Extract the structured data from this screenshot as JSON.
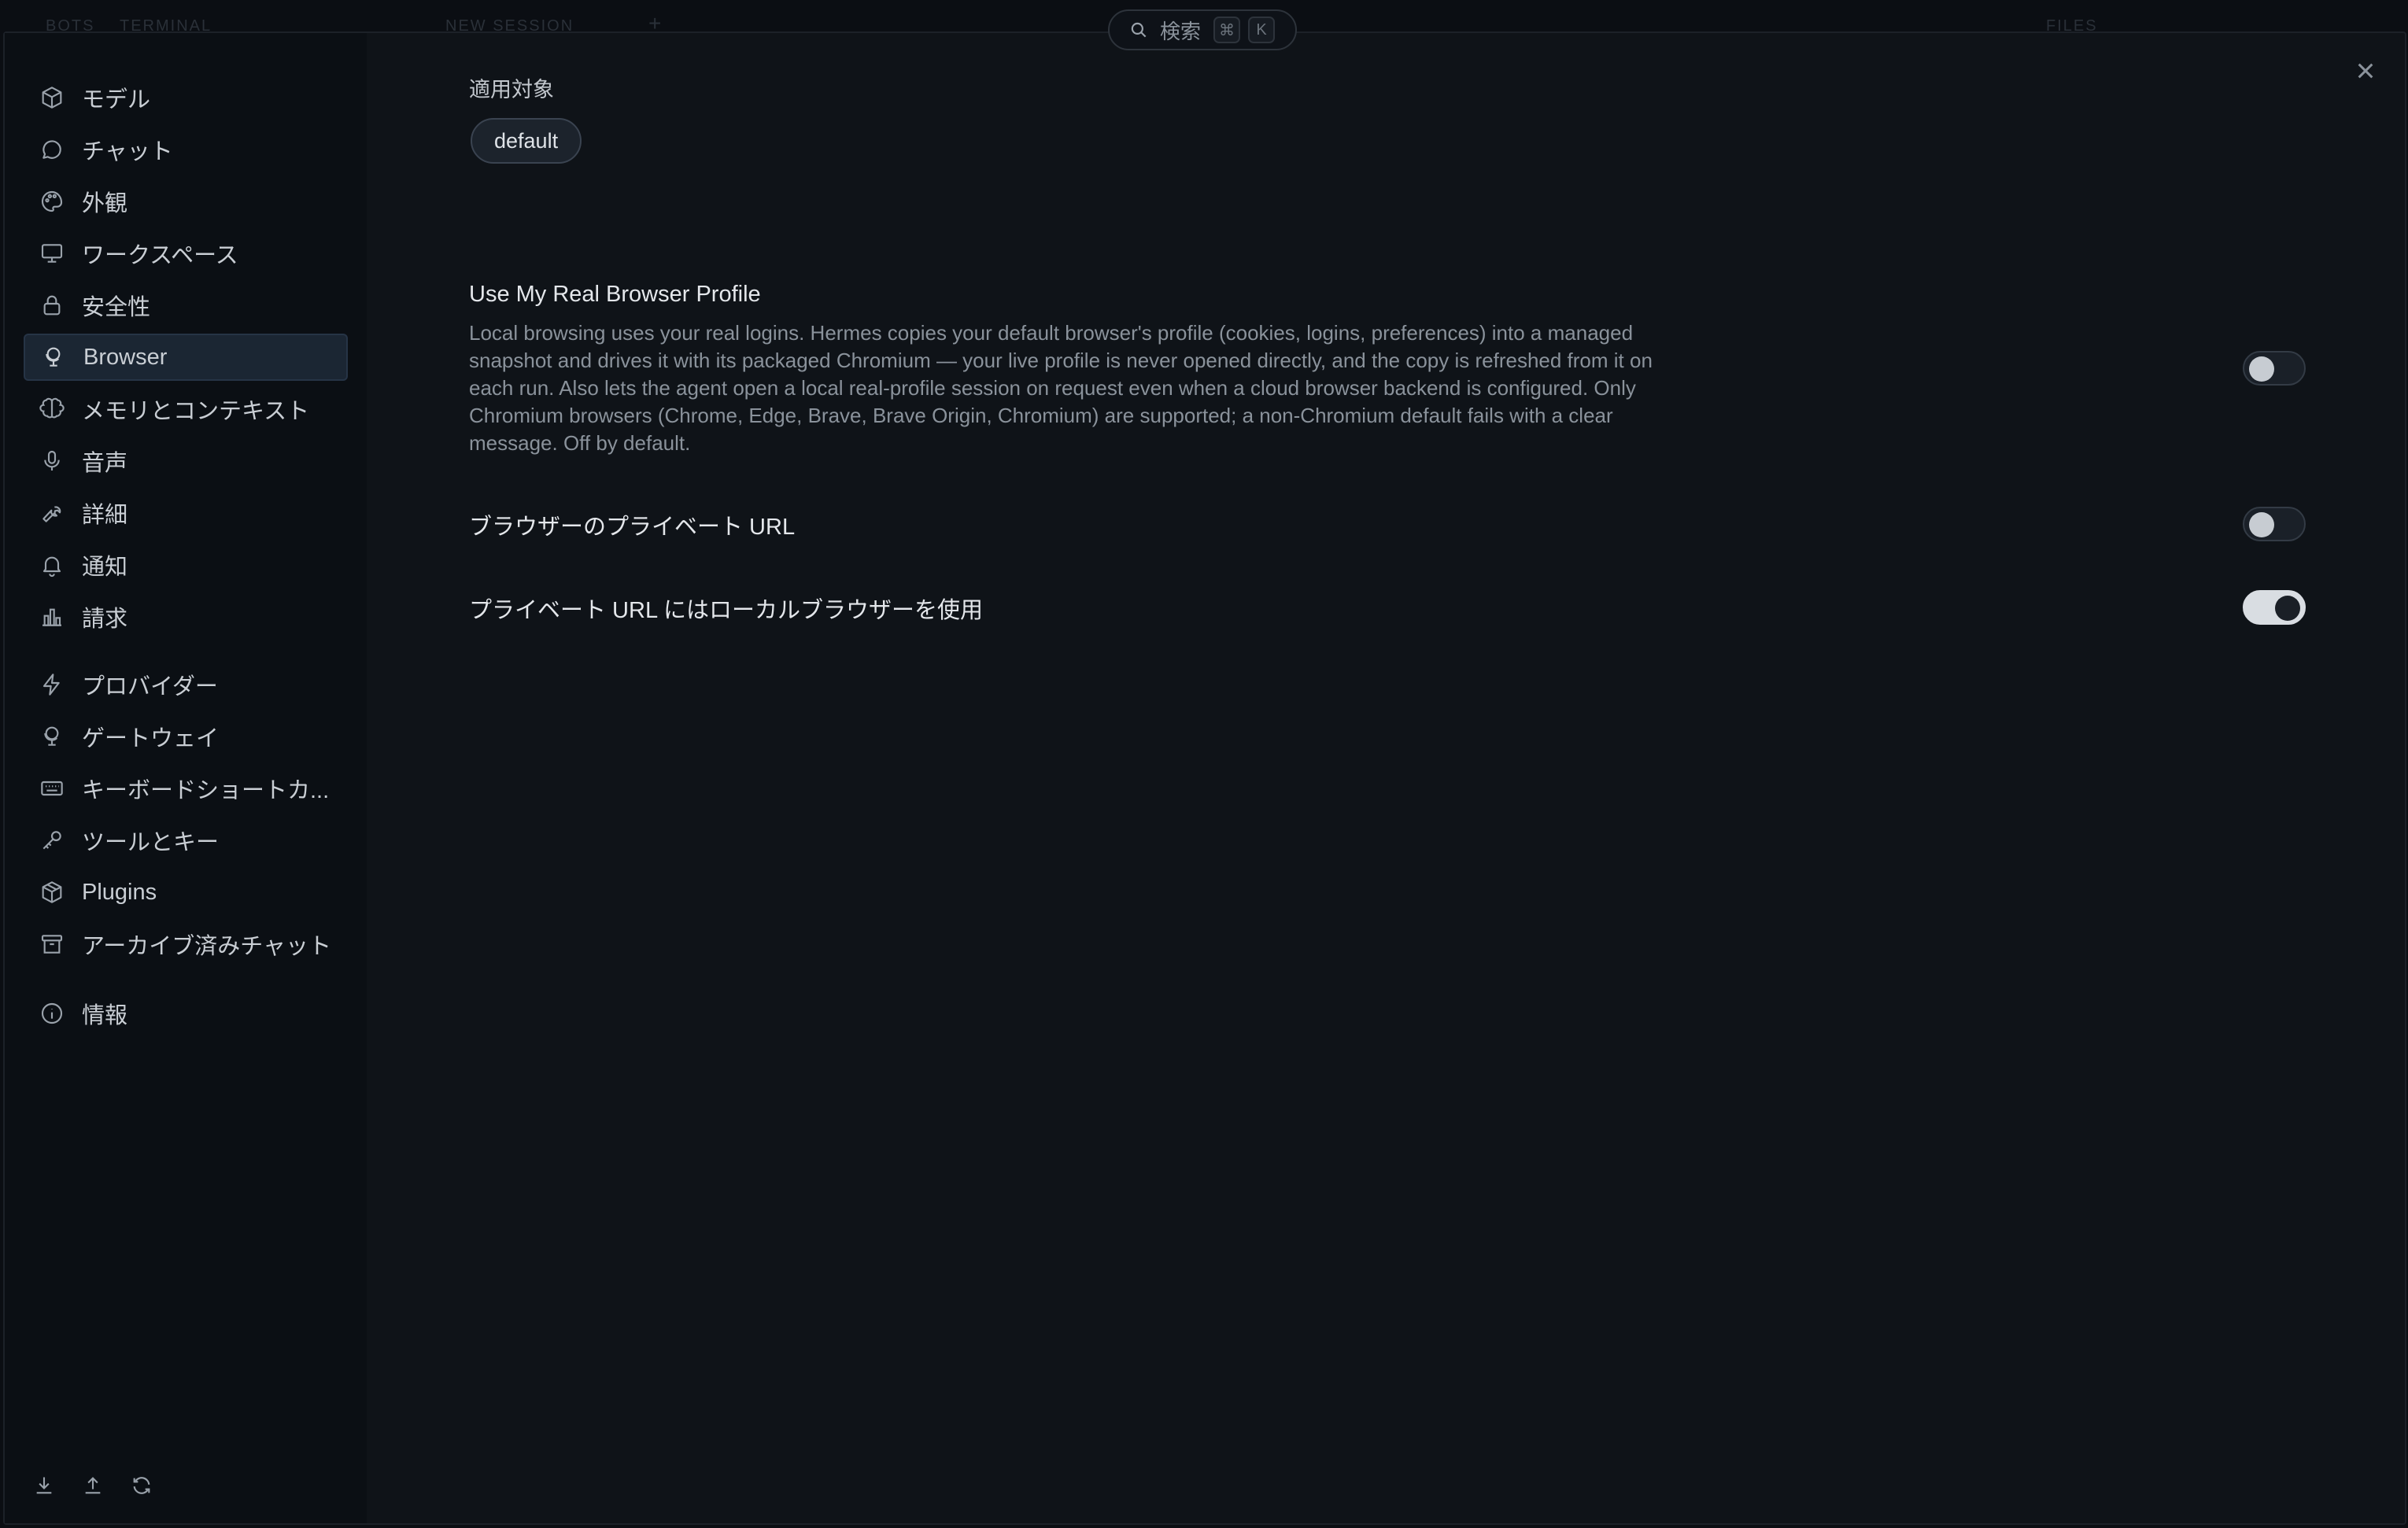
{
  "background": {
    "tabs": [
      "BOTS",
      "TERMINAL",
      "NEW SESSION",
      "FILES"
    ]
  },
  "search": {
    "label": "検索",
    "shortcut_cmd": "⌘",
    "shortcut_key": "K"
  },
  "sidebar": {
    "items": [
      {
        "label": "モデル",
        "icon": "cube-icon"
      },
      {
        "label": "チャット",
        "icon": "chat-bubble-icon"
      },
      {
        "label": "外観",
        "icon": "palette-icon"
      },
      {
        "label": "ワークスペース",
        "icon": "monitor-icon"
      },
      {
        "label": "安全性",
        "icon": "lock-icon"
      },
      {
        "label": "Browser",
        "icon": "globe-stand-icon",
        "active": true
      },
      {
        "label": "メモリとコンテキスト",
        "icon": "brain-icon"
      },
      {
        "label": "音声",
        "icon": "microphone-icon"
      },
      {
        "label": "詳細",
        "icon": "wrench-icon"
      },
      {
        "label": "通知",
        "icon": "bell-icon"
      },
      {
        "label": "請求",
        "icon": "bar-chart-icon"
      },
      {
        "label": "プロバイダー",
        "icon": "lightning-icon"
      },
      {
        "label": "ゲートウェイ",
        "icon": "globe-stand-icon"
      },
      {
        "label": "キーボードショートカ...",
        "icon": "keyboard-icon"
      },
      {
        "label": "ツールとキー",
        "icon": "key-icon"
      },
      {
        "label": "Plugins",
        "icon": "package-icon"
      },
      {
        "label": "アーカイブ済みチャット",
        "icon": "archive-icon"
      },
      {
        "label": "情報",
        "icon": "info-icon"
      }
    ],
    "bottom_icons": [
      "download-icon",
      "upload-icon",
      "refresh-icon"
    ]
  },
  "content": {
    "applies_label": "適用対象",
    "chip": "default",
    "settings": [
      {
        "title": "Use My Real Browser Profile",
        "description": "Local browsing uses your real logins. Hermes copies your default browser's profile (cookies, logins, preferences) into a managed snapshot and drives it with its packaged Chromium — your live profile is never opened directly, and the copy is refreshed from it on each run. Also lets the agent open a local real-profile session on request even when a cloud browser backend is configured. Only Chromium browsers (Chrome, Edge, Brave, Brave Origin, Chromium) are supported; a non-Chromium default fails with a clear message. Off by default.",
        "enabled": false
      },
      {
        "title": "ブラウザーのプライベート URL",
        "enabled": false
      },
      {
        "title": "プライベート URL にはローカルブラウザーを使用",
        "enabled": true
      }
    ]
  },
  "colors": {
    "background": "#0b0e13",
    "sidebar": "#0b0f14",
    "active_item": "#1b2633",
    "toggle_on": "#d9dde2"
  }
}
